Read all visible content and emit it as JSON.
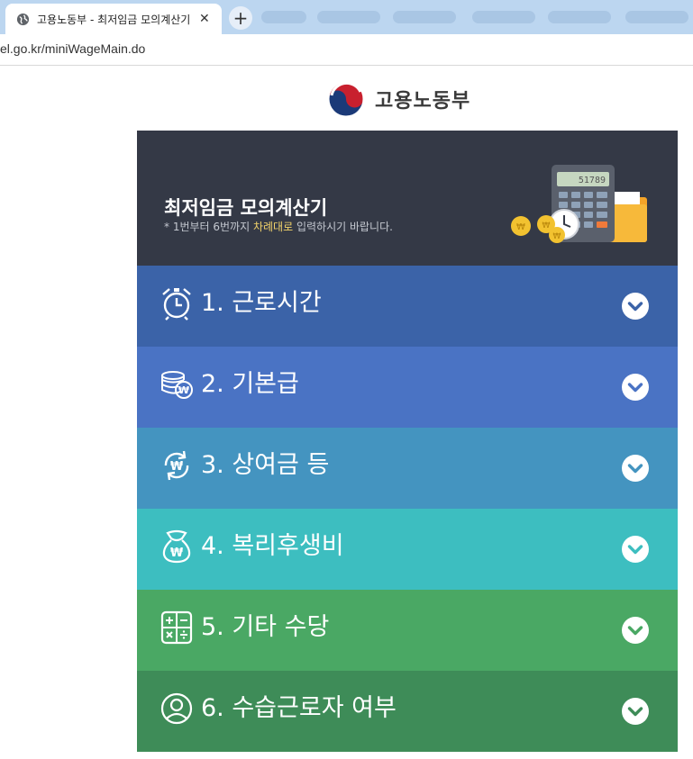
{
  "browser": {
    "tab_title": "고용노동부 - 최저임금 모의계산기",
    "tab_close": "✕",
    "new_tab": "+",
    "url": "el.go.kr/miniWageMain.do"
  },
  "logo": {
    "ministry_name": "고용노동부"
  },
  "calculator": {
    "title": "최저임금 모의계산기",
    "instructions_prefix": "* 1번부터 6번까지 ",
    "instructions_highlight": "차례대로",
    "instructions_suffix": " 입력하시기 바랍니다.",
    "calc_display": "51789",
    "sections": [
      {
        "label": "1. 근로시간",
        "icon": "alarm-clock-icon",
        "color": "#3b63a8"
      },
      {
        "label": "2. 기본급",
        "icon": "coins-icon",
        "color": "#4a73c4"
      },
      {
        "label": "3. 상여금 등",
        "icon": "won-refresh-icon",
        "color": "#4494c0"
      },
      {
        "label": "4. 복리후생비",
        "icon": "money-bag-icon",
        "color": "#3dbec0"
      },
      {
        "label": "5. 기타 수당",
        "icon": "calculator-icon",
        "color": "#4aa864"
      },
      {
        "label": "6. 수습근로자 여부",
        "icon": "person-icon",
        "color": "#3e8c58"
      }
    ]
  }
}
